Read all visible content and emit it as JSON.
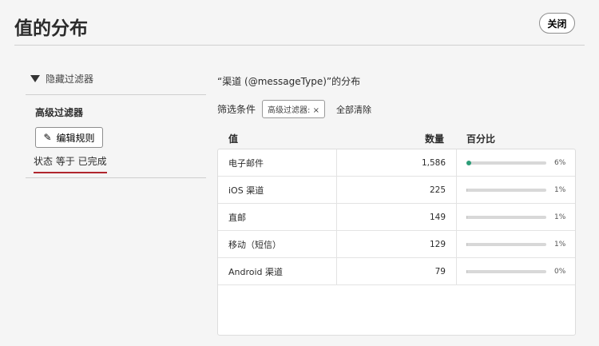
{
  "header": {
    "title": "值的分布",
    "close_label": "关闭"
  },
  "sidebar": {
    "hide_filters": "隐藏过滤器",
    "advanced_filters": "高级过滤器",
    "edit_rules": "编辑规则",
    "rule": "状态 等于 已完成"
  },
  "main": {
    "title": "“渠道 (@messageType)”的分布",
    "filter_label": "筛选条件",
    "chip": "高级过滤器: ×",
    "clear_all": "全部清除",
    "columns": [
      "值",
      "数量",
      "百分比"
    ],
    "rows": [
      {
        "value": "电子邮件",
        "count": "1,586",
        "percent": "6%",
        "fraction": 0.06
      },
      {
        "value": "iOS 渠道",
        "count": "225",
        "percent": "1%",
        "fraction": 0.01
      },
      {
        "value": "直邮",
        "count": "149",
        "percent": "1%",
        "fraction": 0.01
      },
      {
        "value": "移动（短信）",
        "count": "129",
        "percent": "1%",
        "fraction": 0.01
      },
      {
        "value": "Android 渠道",
        "count": "79",
        "percent": "0%",
        "fraction": 0.0
      }
    ]
  },
  "colors": {
    "accent": "#2d9d78",
    "underline": "#b0262e"
  }
}
